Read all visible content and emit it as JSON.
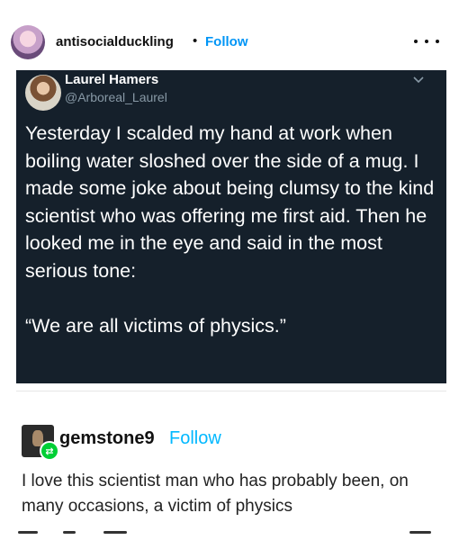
{
  "instagram": {
    "username": "antisocialduckling",
    "separator": "•",
    "follow_label": "Follow",
    "more_icon": "more-horizontal-icon"
  },
  "tweet": {
    "display_name": "Laurel Hamers",
    "handle": "@Arboreal_Laurel",
    "text": "Yesterday I scalded my hand at work when boiling water sloshed over the side of a mug. I made some joke about being clumsy to the kind scientist who was offering me first aid. Then he looked me in the eye and said in the most serious tone:\n\n“We are all victims of physics.”",
    "background": "#15202b"
  },
  "reply": {
    "username": "gemstone9",
    "follow_label": "Follow",
    "reblog_icon": "reblog-icon",
    "text": "I love this scientist man who has probably been, on many occasions, a victim of physics"
  },
  "colors": {
    "instagram_blue": "#0095f6",
    "tumblr_follow": "#00b8ff",
    "reblog_green": "#00cf35"
  }
}
